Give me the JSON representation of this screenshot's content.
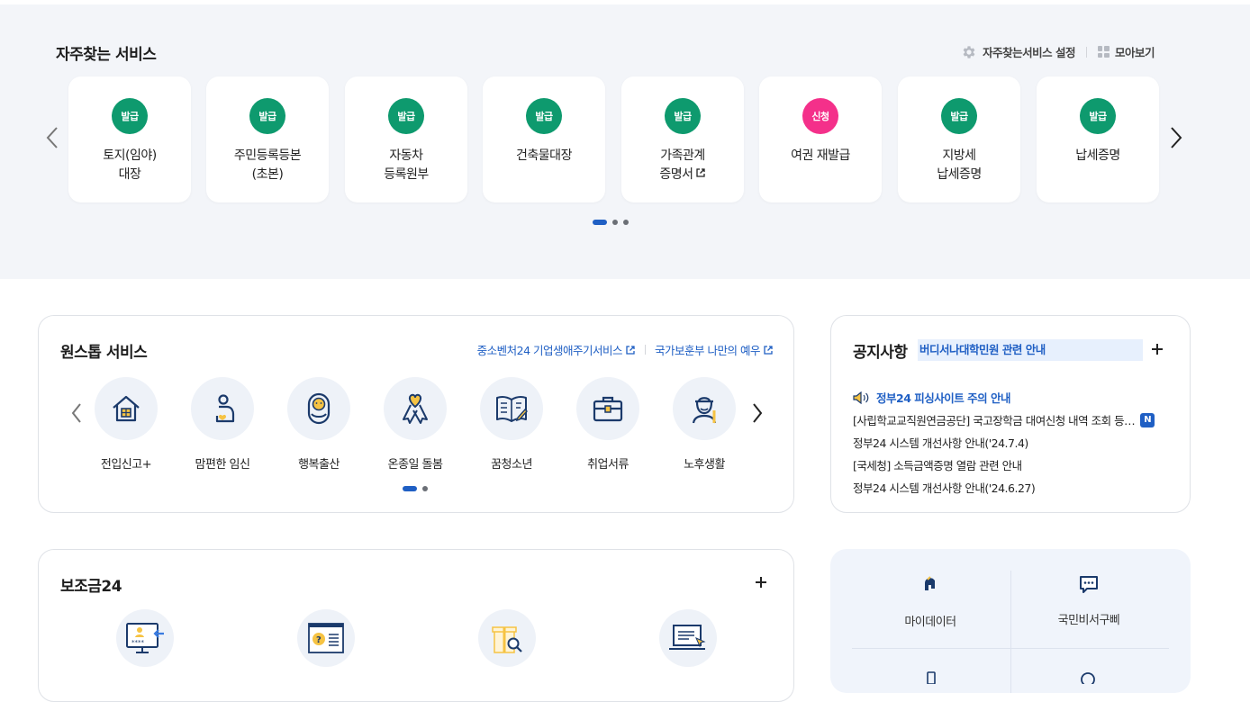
{
  "favorites": {
    "title": "자주찾는 서비스",
    "settings_label": "자주찾는서비스 설정",
    "collect_label": "모아보기",
    "cards": [
      {
        "badge": "발급",
        "badge_type": "issue",
        "line1": "토지(임야)",
        "line2": "대장",
        "external": false
      },
      {
        "badge": "발급",
        "badge_type": "issue",
        "line1": "주민등록등본",
        "line2": "(초본)",
        "external": false
      },
      {
        "badge": "발급",
        "badge_type": "issue",
        "line1": "자동차",
        "line2": "등록원부",
        "external": false
      },
      {
        "badge": "발급",
        "badge_type": "issue",
        "line1": "건축물대장",
        "line2": "",
        "external": false
      },
      {
        "badge": "발급",
        "badge_type": "issue",
        "line1": "가족관계",
        "line2": "증명서",
        "external": true
      },
      {
        "badge": "신청",
        "badge_type": "apply",
        "line1": "여권 재발급",
        "line2": "",
        "external": false
      },
      {
        "badge": "발급",
        "badge_type": "issue",
        "line1": "지방세",
        "line2": "납세증명",
        "external": false
      },
      {
        "badge": "발급",
        "badge_type": "issue",
        "line1": "납세증명",
        "line2": "",
        "external": false
      }
    ],
    "pages": 3,
    "active_page": 1,
    "colors": {
      "issue": "#0e9a6e",
      "apply": "#f4308a",
      "accent": "#1f5fc4"
    }
  },
  "onestop": {
    "title": "원스톱 서비스",
    "links": [
      "중소벤처24 기업생애주기서비스",
      "국가보훈부 나만의 예우"
    ],
    "items": [
      {
        "label": "전입신고+",
        "icon": "house-icon"
      },
      {
        "label": "맘편한 임신",
        "icon": "pregnancy-icon"
      },
      {
        "label": "행복출산",
        "icon": "baby-icon"
      },
      {
        "label": "온종일 돌봄",
        "icon": "ribbon-icon"
      },
      {
        "label": "꿈청소년",
        "icon": "book-icon"
      },
      {
        "label": "취업서류",
        "icon": "briefcase-icon"
      },
      {
        "label": "노후생활",
        "icon": "elder-icon"
      }
    ],
    "pages": 2,
    "active_page": 1
  },
  "notice": {
    "title": "공지사항",
    "ticker": "버디서나대학민원 관련 안내",
    "items": [
      {
        "text": "정부24 피싱사이트 주의 안내",
        "highlight": true,
        "new": false
      },
      {
        "text": "[사립학교교직원연금공단] 국고장학금 대여신청 내역 조회 등…",
        "highlight": false,
        "new": true
      },
      {
        "text": "정부24 시스템 개선사항 안내('24.7.4)",
        "highlight": false,
        "new": false
      },
      {
        "text": "[국세청] 소득금액증명 열람 관련 안내",
        "highlight": false,
        "new": false
      },
      {
        "text": "정부24 시스템 개선사항 안내('24.6.27)",
        "highlight": false,
        "new": false
      }
    ],
    "new_badge": "N"
  },
  "subsidy": {
    "title": "보조금24",
    "items": [
      {
        "icon": "monitor-password-icon"
      },
      {
        "icon": "question-document-icon"
      },
      {
        "icon": "gift-search-icon"
      },
      {
        "icon": "laptop-click-icon"
      }
    ]
  },
  "quick": {
    "items": [
      {
        "label": "마이데이터",
        "icon": "mydata-icon"
      },
      {
        "label": "국민비서구삐",
        "icon": "chat-icon"
      }
    ]
  }
}
